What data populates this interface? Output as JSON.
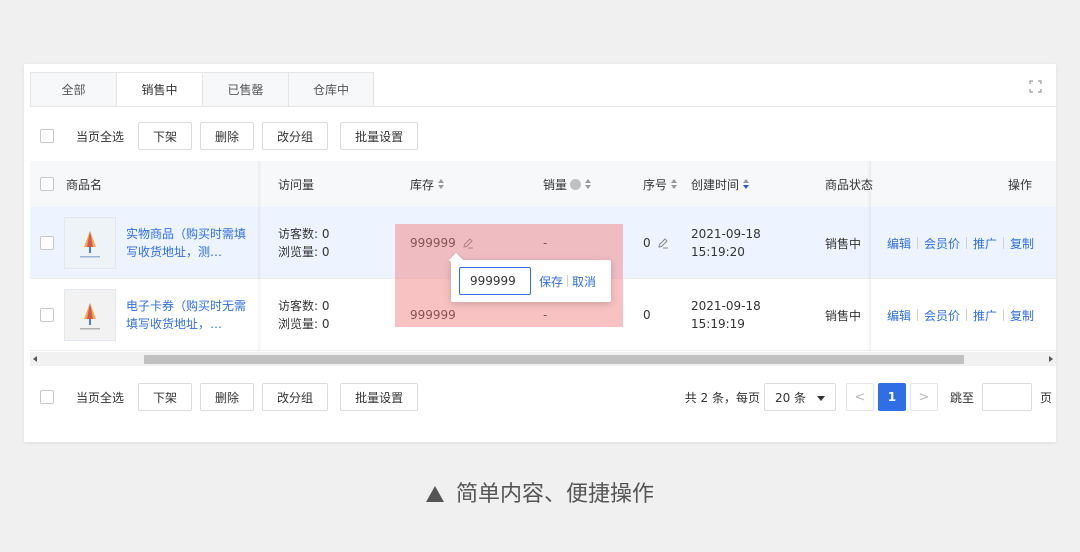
{
  "tabs": [
    {
      "label": "全部",
      "active": false
    },
    {
      "label": "销售中",
      "active": true
    },
    {
      "label": "已售罄",
      "active": false
    },
    {
      "label": "仓库中",
      "active": false
    }
  ],
  "toolbar": {
    "select_all": "当页全选",
    "buttons": [
      "下架",
      "删除",
      "改分组",
      "批量设置"
    ]
  },
  "columns": {
    "name": "商品名",
    "visits": "访问量",
    "stock": "库存",
    "sales": "销量",
    "order": "序号",
    "created": "创建时间",
    "status": "商品状态",
    "actions": "操作"
  },
  "rows": [
    {
      "name": "实物商品（购买时需填写收货地址，测…",
      "visitors": "访客数: 0",
      "views": "浏览量: 0",
      "stock": "999999",
      "sales": "-",
      "order": "0",
      "date": "2021-09-18",
      "time": "15:19:20",
      "status": "销售中"
    },
    {
      "name": "电子卡券（购买时无需填写收货地址，…",
      "visitors": "访客数: 0",
      "views": "浏览量: 0",
      "stock": "999999",
      "sales": "-",
      "order": "0",
      "date": "2021-09-18",
      "time": "15:19:19",
      "status": "销售中"
    }
  ],
  "row_actions": [
    "编辑",
    "会员价",
    "推广",
    "复制"
  ],
  "stock_editor": {
    "value": "999999",
    "save": "保存",
    "cancel": "取消"
  },
  "pagination": {
    "total": "共 2 条，每页",
    "page_size": "20 条",
    "prev": "<",
    "current": "1",
    "next": ">",
    "jump_label": "跳至",
    "page_suffix": "页"
  },
  "caption": "简单内容、便捷操作",
  "colors": {
    "accent": "#2f6ee5",
    "highlight": "#f07878"
  }
}
